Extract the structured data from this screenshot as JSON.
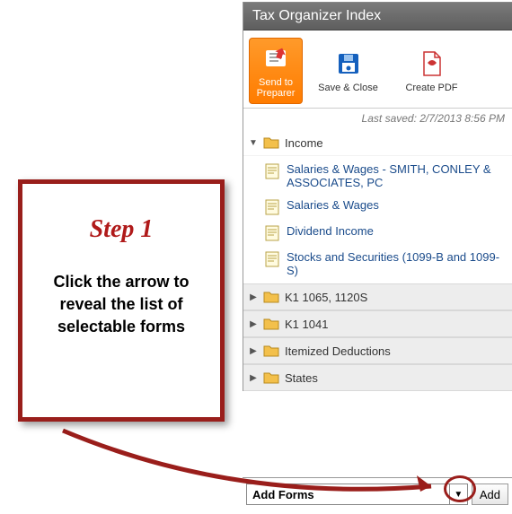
{
  "callout": {
    "step": "Step 1",
    "body": "Click the arrow to reveal the list of selectable forms"
  },
  "panel": {
    "title": "Tax Organizer Index"
  },
  "toolbar": {
    "send_label": "Send to Preparer",
    "save_label": "Save & Close",
    "pdf_label": "Create PDF"
  },
  "status": {
    "last_saved": "Last saved: 2/7/2013 8:56 PM"
  },
  "tree": {
    "income_label": "Income",
    "income_items": [
      "Salaries & Wages - SMITH, CONLEY & ASSOCIATES, PC",
      "Salaries & Wages",
      "Dividend Income",
      "Stocks and Securities (1099-B and 1099-S)"
    ],
    "folders": [
      "K1 1065, 1120S",
      "K1 1041",
      "Itemized Deductions",
      "States"
    ]
  },
  "add_bar": {
    "select_label": "Add Forms",
    "add_button": "Add"
  }
}
